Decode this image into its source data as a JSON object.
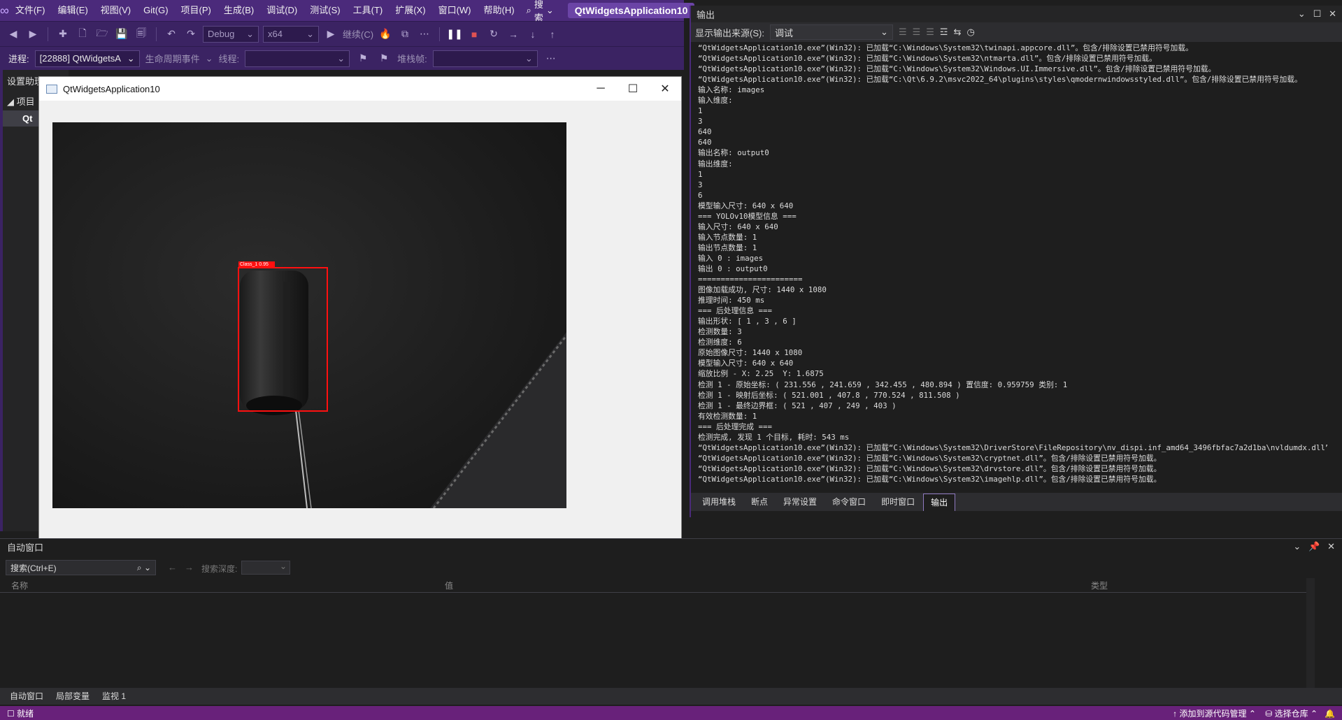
{
  "menu": {
    "items": [
      "文件(F)",
      "编辑(E)",
      "视图(V)",
      "Git(G)",
      "项目(P)",
      "生成(B)",
      "调试(D)",
      "测试(S)",
      "工具(T)",
      "扩展(X)",
      "窗口(W)",
      "帮助(H)"
    ],
    "search_label": "搜索",
    "app_title": "QtWidgetsApplication10"
  },
  "toolbar": {
    "config": "Debug",
    "platform": "x64",
    "continue_label": "继续(C)"
  },
  "process_bar": {
    "process_label": "进程:",
    "process_value": "[22888] QtWidgetsA",
    "lifecycle_label": "生命周期事件",
    "thread_label": "线程:",
    "stack_label": "堆栈帧:"
  },
  "left_dock": {
    "title": "设置助理",
    "project_label": "项目",
    "item": "Qt"
  },
  "qt_window": {
    "title": "QtWidgetsApplication10",
    "detection_label": "Class_1  0.95"
  },
  "output": {
    "title": "输出",
    "source_label": "显示输出来源(S):",
    "source_value": "调试",
    "lines": [
      "“QtWidgetsApplication10.exe”(Win32): 已加载“C:\\Windows\\System32\\twinapi.appcore.dll”。包含/排除设置已禁用符号加载。",
      "“QtWidgetsApplication10.exe”(Win32): 已加载“C:\\Windows\\System32\\ntmarta.dll”。包含/排除设置已禁用符号加载。",
      "“QtWidgetsApplication10.exe”(Win32): 已加载“C:\\Windows\\System32\\Windows.UI.Immersive.dll”。包含/排除设置已禁用符号加载。",
      "“QtWidgetsApplication10.exe”(Win32): 已加载“C:\\Qt\\6.9.2\\msvc2022_64\\plugins\\styles\\qmodernwindowsstyled.dll”。包含/排除设置已禁用符号加载。",
      "输入名称: images",
      "输入维度:",
      "1",
      "3",
      "640",
      "640",
      "输出名称: output0",
      "输出维度:",
      "1",
      "3",
      "6",
      "模型输入尺寸: 640 x 640",
      "=== YOLOv10模型信息 ===",
      "输入尺寸: 640 x 640",
      "输入节点数量: 1",
      "输出节点数量: 1",
      "输入 0 : images",
      "输出 0 : output0",
      "=======================",
      "图像加载成功, 尺寸: 1440 x 1080",
      "推理时间: 450 ms",
      "=== 后处理信息 ===",
      "输出形状: [ 1 , 3 , 6 ]",
      "检测数量: 3",
      "检测维度: 6",
      "原始图像尺寸: 1440 x 1080",
      "模型输入尺寸: 640 x 640",
      "缩放比例 - X: 2.25  Y: 1.6875",
      "检测 1 - 原始坐标: ( 231.556 , 241.659 , 342.455 , 480.894 ) 置信度: 0.959759 类别: 1",
      "检测 1 - 映射后坐标: ( 521.001 , 407.8 , 770.524 , 811.508 )",
      "检测 1 - 最终边界框: ( 521 , 407 , 249 , 403 )",
      "有效检测数量: 1",
      "=== 后处理完成 ===",
      "检测完成, 发现 1 个目标, 耗时: 543 ms",
      "“QtWidgetsApplication10.exe”(Win32): 已加载“C:\\Windows\\System32\\DriverStore\\FileRepository\\nv_dispi.inf_amd64_3496fbfac7a2d1ba\\nvldumdx.dll”。包含",
      "“QtWidgetsApplication10.exe”(Win32): 已加载“C:\\Windows\\System32\\cryptnet.dll”。包含/排除设置已禁用符号加载。",
      "“QtWidgetsApplication10.exe”(Win32): 已加载“C:\\Windows\\System32\\drvstore.dll”。包含/排除设置已禁用符号加载。",
      "“QtWidgetsApplication10.exe”(Win32): 已加载“C:\\Windows\\System32\\imagehlp.dll”。包含/排除设置已禁用符号加载。"
    ],
    "tabs": [
      "调用堆栈",
      "断点",
      "异常设置",
      "命令窗口",
      "即时窗口",
      "输出"
    ]
  },
  "autos": {
    "title": "自动窗口",
    "search_placeholder": "搜索(Ctrl+E)",
    "depth_label": "搜索深度:",
    "col_name": "名称",
    "col_value": "值",
    "col_type": "类型"
  },
  "bottom_tabs": [
    "自动窗口",
    "局部变量",
    "监视 1"
  ],
  "status": {
    "left": "就绪",
    "add_source": "添加到源代码管理",
    "select_repo": "选择仓库"
  }
}
